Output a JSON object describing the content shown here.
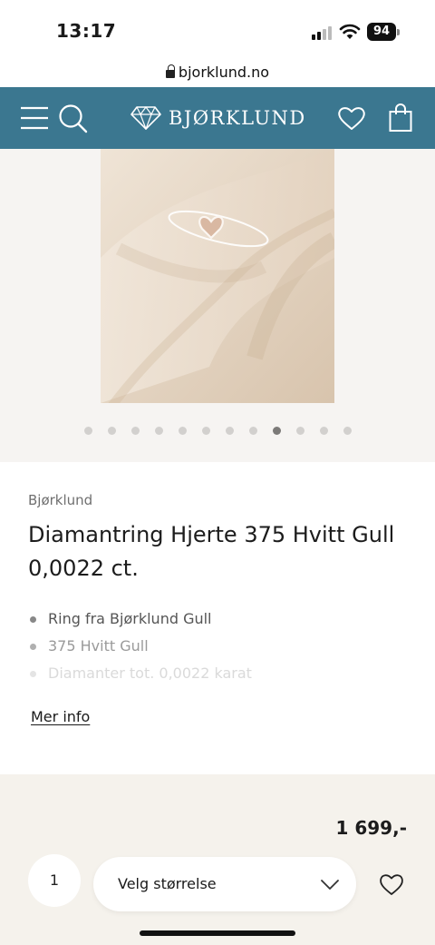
{
  "status_bar": {
    "time": "13:17",
    "battery": "94"
  },
  "browser": {
    "url": "bjorklund.no"
  },
  "header": {
    "logo_text": "BJØRKLUND",
    "icons": [
      "menu-icon",
      "search-icon",
      "diamond-logo-icon",
      "heart-icon",
      "shopping-bag-icon"
    ],
    "background": "#3b7790"
  },
  "gallery": {
    "image_count": 12,
    "active_index": 8
  },
  "product": {
    "brand": "Bjørklund",
    "title": "Diamantring Hjerte 375 Hvitt Gull 0,0022 ct.",
    "bullets": [
      "Ring fra Bjørklund Gull",
      "375 Hvitt Gull",
      "Diamanter tot. 0,0022 karat"
    ],
    "more_info_label": "Mer info"
  },
  "purchase": {
    "price": "1 699,-",
    "quantity": "1",
    "size_placeholder": "Velg størrelse"
  }
}
